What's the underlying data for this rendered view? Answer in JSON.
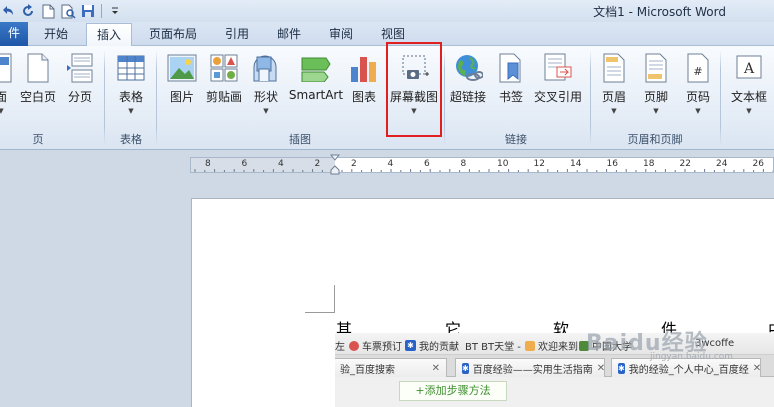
{
  "window": {
    "title": "文档1  -  Microsoft Word"
  },
  "tabs": [
    {
      "label": "件"
    },
    {
      "label": "开始"
    },
    {
      "label": "插入"
    },
    {
      "label": "页面布局"
    },
    {
      "label": "引用"
    },
    {
      "label": "邮件"
    },
    {
      "label": "审阅"
    },
    {
      "label": "视图"
    }
  ],
  "ribbon": {
    "buttons": [
      {
        "label": "面"
      },
      {
        "label": "空白页"
      },
      {
        "label": "分页"
      },
      {
        "label": "表格"
      },
      {
        "label": "图片"
      },
      {
        "label": "剪贴画"
      },
      {
        "label": "形状"
      },
      {
        "label": "SmartArt"
      },
      {
        "label": "图表"
      },
      {
        "label": "屏幕截图"
      },
      {
        "label": "超链接"
      },
      {
        "label": "书签"
      },
      {
        "label": "交叉引用"
      },
      {
        "label": "页眉"
      },
      {
        "label": "页脚"
      },
      {
        "label": "页码"
      },
      {
        "label": "文本框"
      }
    ],
    "groups": [
      {
        "label": "页"
      },
      {
        "label": "表格"
      },
      {
        "label": "插图"
      },
      {
        "label": "链接"
      },
      {
        "label": "页眉和页脚"
      }
    ]
  },
  "ruler": {
    "labels": [
      "8",
      "6",
      "4",
      "2",
      "2",
      "4",
      "6",
      "8",
      "10",
      "12",
      "14",
      "16",
      "18",
      "22",
      "24",
      "26"
    ]
  },
  "document": {
    "chars": [
      "其",
      "它",
      "软",
      "件",
      "中"
    ]
  },
  "browser": {
    "bookmarks": [
      {
        "label": "左"
      },
      {
        "label": "车票预订"
      },
      {
        "label": "我的贡献"
      },
      {
        "label": "BT BT天堂 -"
      },
      {
        "label": "欢迎来到"
      },
      {
        "label": "中国大学"
      },
      {
        "label": "3wcoffe"
      }
    ],
    "tabs": [
      {
        "label": "验_百度搜索"
      },
      {
        "label": "百度经验——实用生活指南"
      },
      {
        "label": "我的经验_个人中心_百度经"
      }
    ],
    "add_step": "+添加步骤方法"
  },
  "watermark": {
    "text": "Baidu经验",
    "sub": "jingyan.baidu.com"
  },
  "colors": {
    "highlight": "#e02020",
    "file_tab": "#2a62b4",
    "add_step": "#3f8f2e"
  }
}
